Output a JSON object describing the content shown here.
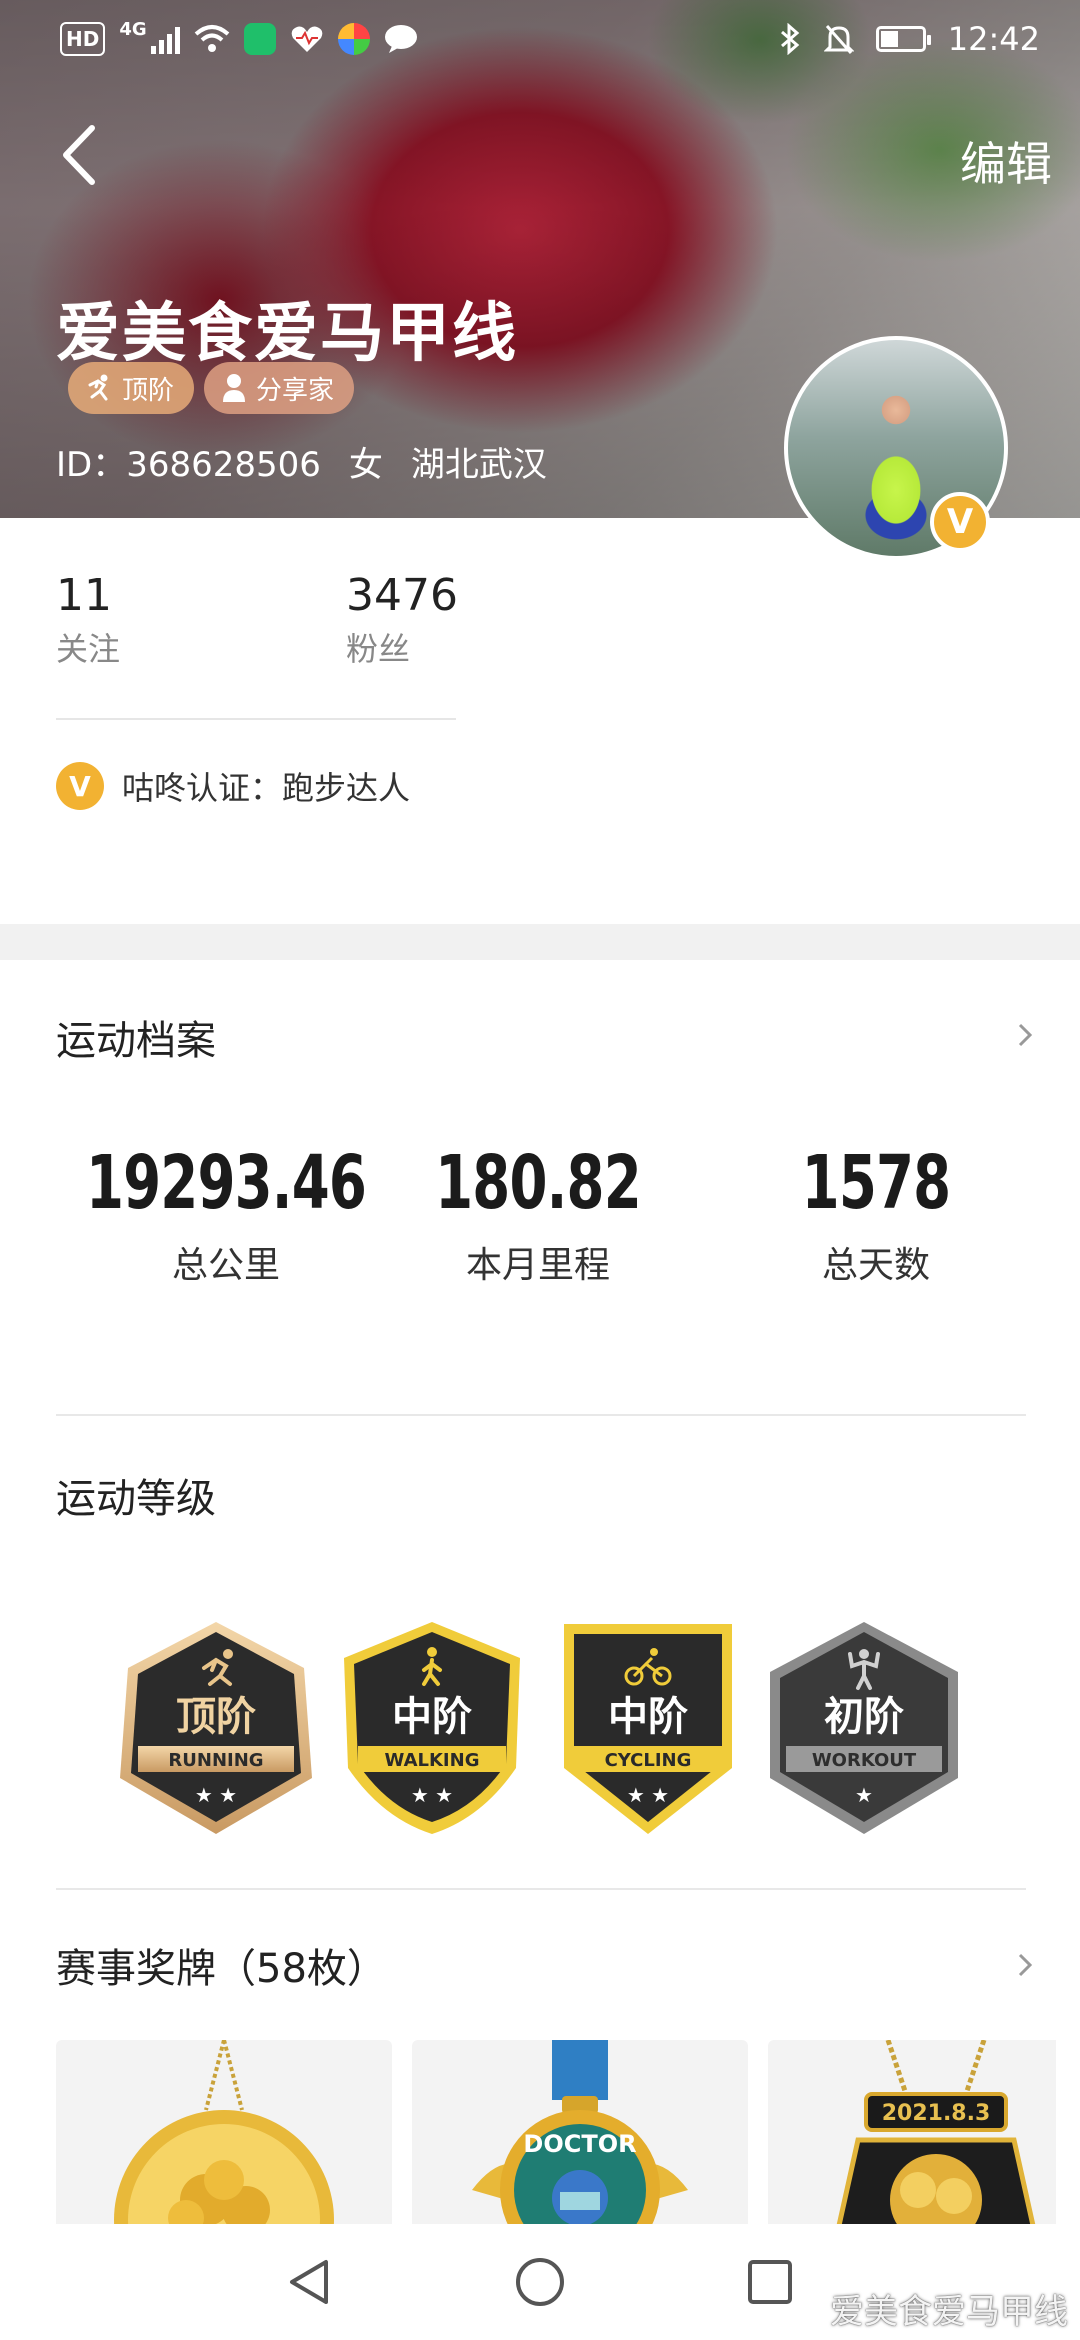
{
  "status_bar": {
    "hd_label": "HD",
    "net_label": "4G",
    "time": "12:42"
  },
  "header": {
    "edit_label": "编辑",
    "username": "爱美食爱马甲线",
    "tags": [
      {
        "label": "顶阶",
        "icon": "running-icon"
      },
      {
        "label": "分享家",
        "icon": "person-icon"
      }
    ],
    "id_text": "ID：368628506",
    "gender": "女",
    "location": "湖北武汉",
    "avatar_badge": "V"
  },
  "social": {
    "following_count": "11",
    "following_label": "关注",
    "fans_count": "3476",
    "fans_label": "粉丝"
  },
  "certification": {
    "badge": "V",
    "text": "咕咚认证：跑步达人"
  },
  "sports_record": {
    "title": "运动档案",
    "stats": [
      {
        "value": "19293.46",
        "label": "总公里"
      },
      {
        "value": "180.82",
        "label": "本月里程"
      },
      {
        "value": "1578",
        "label": "总天数"
      }
    ]
  },
  "sports_level": {
    "title": "运动等级",
    "badges": [
      {
        "level": "顶阶",
        "type": "RUNNING",
        "stars": "★ ★",
        "theme": "bronze",
        "icon": "running-icon"
      },
      {
        "level": "中阶",
        "type": "WALKING",
        "stars": "★ ★",
        "theme": "gold",
        "icon": "walking-icon"
      },
      {
        "level": "中阶",
        "type": "CYCLING",
        "stars": "★ ★",
        "theme": "gold",
        "icon": "cycling-icon"
      },
      {
        "level": "初阶",
        "type": "WORKOUT",
        "stars": "★",
        "theme": "gray",
        "icon": "workout-icon"
      }
    ]
  },
  "medals": {
    "title": "赛事奖牌（58枚）",
    "items": [
      {
        "icon": "flower-medal-icon"
      },
      {
        "icon": "doctor-medal-icon",
        "text": "DOCTOR"
      },
      {
        "icon": "date-medal-icon",
        "text": "2021.8.3"
      }
    ]
  },
  "watermark": "爱美食爱马甲线",
  "colors": {
    "accent_gold": "#f2b232",
    "text_primary": "#222222",
    "text_secondary": "#888888",
    "band_gray": "#f1f1f1"
  }
}
